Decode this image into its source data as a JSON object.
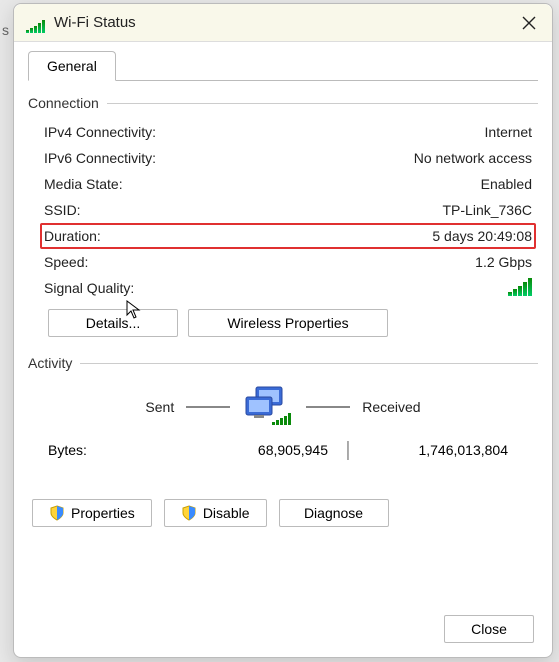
{
  "window": {
    "title": "Wi-Fi Status"
  },
  "tabs": {
    "general": "General"
  },
  "connection": {
    "header": "Connection",
    "ipv4_label": "IPv4 Connectivity:",
    "ipv4_value": "Internet",
    "ipv6_label": "IPv6 Connectivity:",
    "ipv6_value": "No network access",
    "media_label": "Media State:",
    "media_value": "Enabled",
    "ssid_label": "SSID:",
    "ssid_value": "TP-Link_736C",
    "duration_label": "Duration:",
    "duration_value": "5 days 20:49:08",
    "speed_label": "Speed:",
    "speed_value": "1.2 Gbps",
    "signal_label": "Signal Quality:"
  },
  "buttons": {
    "details": "Details...",
    "wireless_props": "Wireless Properties"
  },
  "activity": {
    "header": "Activity",
    "sent_label": "Sent",
    "received_label": "Received",
    "bytes_label": "Bytes:",
    "bytes_sent": "68,905,945",
    "bytes_received": "1,746,013,804"
  },
  "actions": {
    "properties": "Properties",
    "disable": "Disable",
    "diagnose": "Diagnose"
  },
  "footer": {
    "close": "Close"
  },
  "left_hint": "s"
}
